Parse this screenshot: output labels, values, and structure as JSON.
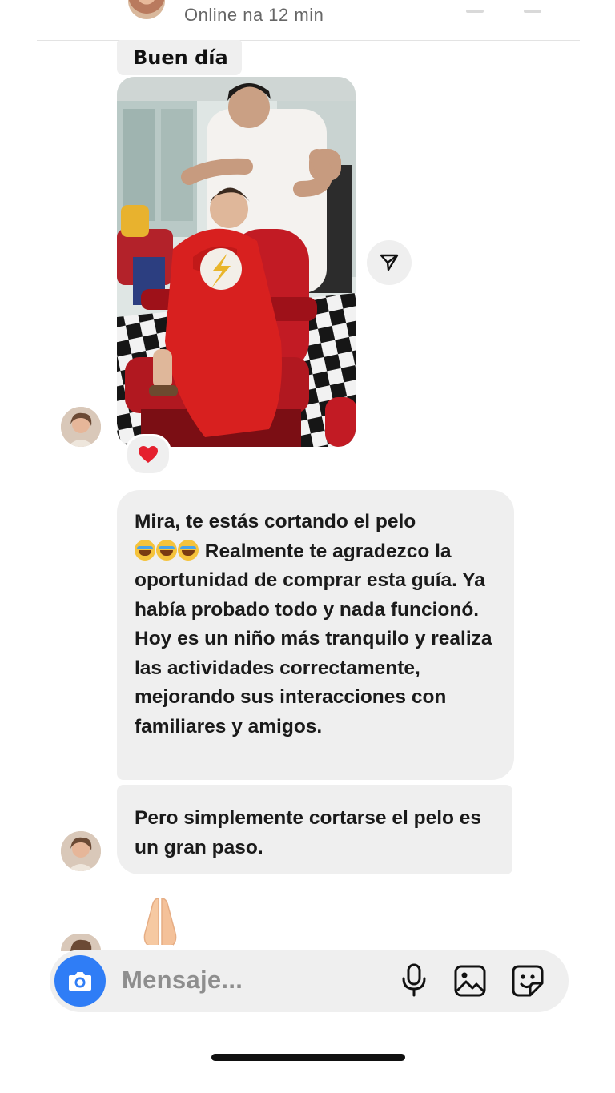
{
  "header": {
    "status": "Online na 12 min"
  },
  "thread": {
    "photo_caption": "Buen día",
    "reaction": "❤️",
    "message_1": {
      "line_1": "Mira, te estás cortando el pelo",
      "emoji": "😂😂😂",
      "line_2": " Realmente te agradezco la",
      "rest": "oportunidad de comprar esta guía. Ya había probado todo y nada funcionó. Hoy es un niño más tranquilo y realiza las actividades correctamente, mejorando sus interacciones con familiares y amigos."
    },
    "message_2": "Pero simplemente cortarse el pelo es un gran paso.",
    "pray_emoji": "🙏"
  },
  "composer": {
    "placeholder": "Mensaje..."
  },
  "icons": {
    "camera": "camera-icon",
    "microphone": "microphone-icon",
    "gallery": "gallery-icon",
    "sticker": "sticker-icon",
    "share": "share-icon"
  },
  "colors": {
    "accent": "#2f7df6",
    "bubble": "#efefef",
    "heart": "#e5202e"
  }
}
